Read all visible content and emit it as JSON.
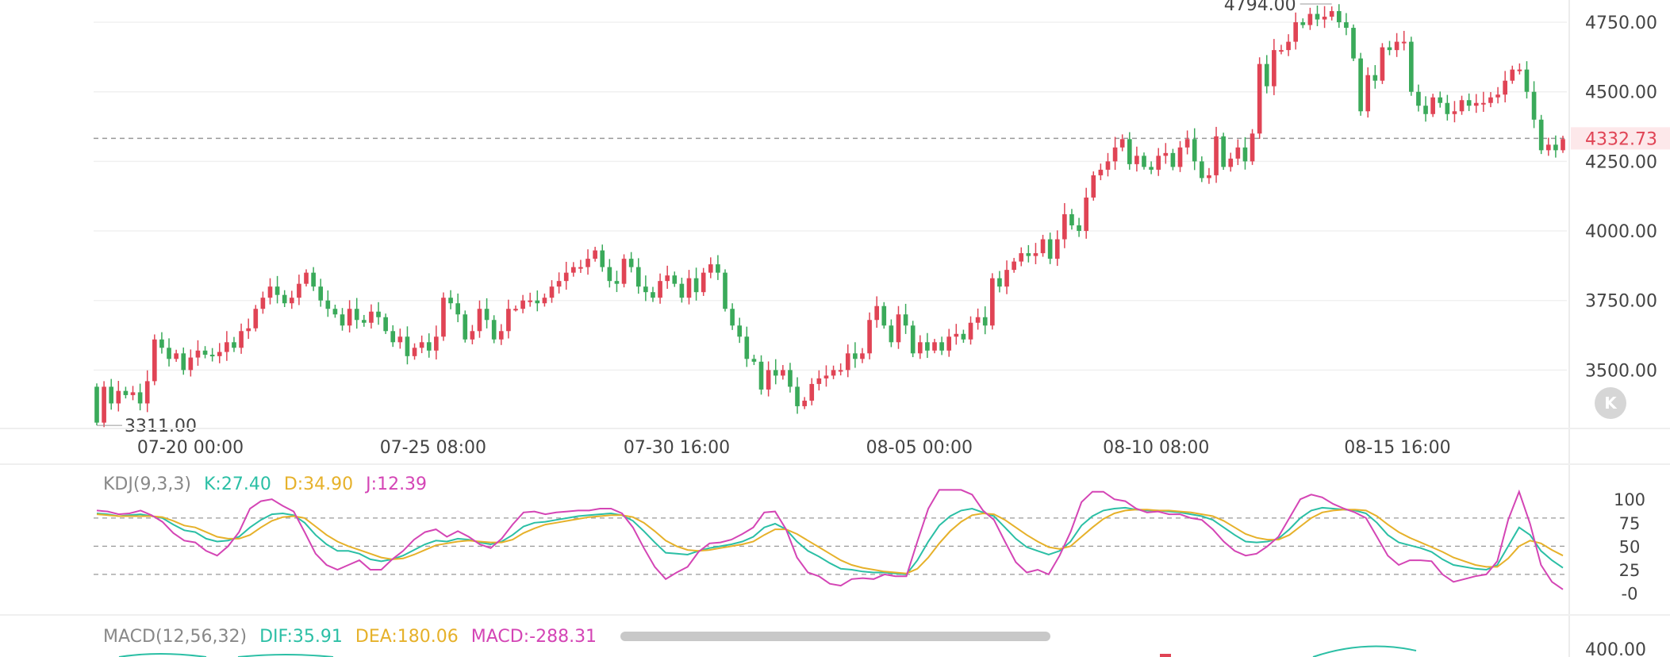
{
  "chart_data": [
    {
      "type": "candlestick",
      "panel": "price",
      "x_tick_labels": [
        "07-20 00:00",
        "07-25 08:00",
        "07-30 16:00",
        "08-05 00:00",
        "08-10 08:00",
        "08-15 16:00"
      ],
      "y_tick_labels": [
        "4750.00",
        "4500.00",
        "4250.00",
        "4000.00",
        "3750.00",
        "3500.00"
      ],
      "ylim": [
        3290,
        4830
      ],
      "high_label": "4794.00",
      "low_label": "3311.00",
      "last_price_label": "4332.73",
      "last_price": 4332.73,
      "colors": {
        "up": "#e04455",
        "down": "#3aaa5a",
        "last_price": "#e04455"
      },
      "series": [
        {
          "name": "close",
          "values": [
            3311,
            3440,
            3380,
            3425,
            3410,
            3420,
            3380,
            3460,
            3610,
            3580,
            3540,
            3560,
            3500,
            3545,
            3570,
            3555,
            3550,
            3565,
            3600,
            3580,
            3640,
            3650,
            3720,
            3760,
            3800,
            3770,
            3740,
            3760,
            3810,
            3850,
            3800,
            3750,
            3720,
            3700,
            3660,
            3720,
            3680,
            3670,
            3710,
            3690,
            3640,
            3600,
            3620,
            3550,
            3580,
            3600,
            3570,
            3620,
            3760,
            3740,
            3700,
            3610,
            3640,
            3720,
            3680,
            3610,
            3640,
            3720,
            3720,
            3750,
            3750,
            3740,
            3760,
            3800,
            3820,
            3850,
            3870,
            3870,
            3900,
            3930,
            3870,
            3820,
            3810,
            3900,
            3870,
            3800,
            3780,
            3760,
            3820,
            3840,
            3810,
            3760,
            3830,
            3780,
            3850,
            3880,
            3850,
            3720,
            3660,
            3620,
            3540,
            3530,
            3430,
            3500,
            3480,
            3500,
            3440,
            3370,
            3390,
            3450,
            3470,
            3480,
            3500,
            3500,
            3560,
            3540,
            3560,
            3680,
            3730,
            3660,
            3600,
            3700,
            3660,
            3560,
            3600,
            3570,
            3600,
            3570,
            3620,
            3630,
            3610,
            3670,
            3690,
            3660,
            3830,
            3800,
            3860,
            3890,
            3920,
            3910,
            3920,
            3970,
            3900,
            3970,
            4060,
            4020,
            4000,
            4120,
            4200,
            4220,
            4250,
            4300,
            4330,
            4240,
            4270,
            4230,
            4220,
            4270,
            4280,
            4230,
            4300,
            4330,
            4250,
            4190,
            4200,
            4340,
            4230,
            4260,
            4300,
            4250,
            4350,
            4600,
            4520,
            4650,
            4650,
            4680,
            4750,
            4740,
            4780,
            4760,
            4770,
            4790,
            4750,
            4730,
            4620,
            4430,
            4560,
            4540,
            4660,
            4650,
            4680,
            4680,
            4500,
            4450,
            4420,
            4480,
            4460,
            4420,
            4430,
            4470,
            4450,
            4460,
            4460,
            4480,
            4490,
            4540,
            4580,
            4580,
            4500,
            4400,
            4290,
            4310,
            4290,
            4330
          ]
        }
      ]
    },
    {
      "type": "line",
      "panel": "KDJ",
      "y_tick_labels": [
        "100",
        "75",
        "50",
        "25",
        "-0"
      ],
      "ylim": [
        -8,
        112
      ],
      "reference_lines": [
        80,
        50,
        20
      ],
      "x": [
        0,
        10,
        20,
        30,
        40,
        50,
        60,
        70,
        80,
        90,
        100,
        110,
        120,
        130,
        140,
        150,
        160,
        170,
        180,
        190,
        200,
        210,
        220,
        230,
        240,
        250,
        260,
        270,
        280,
        290,
        300,
        310,
        320,
        330,
        340,
        350,
        360,
        370,
        380,
        390,
        400,
        410,
        420,
        430,
        440,
        450,
        460,
        470,
        480,
        490,
        500,
        510,
        520,
        530,
        540,
        550,
        560,
        570,
        580,
        590,
        600,
        610,
        620,
        630,
        640,
        650,
        660,
        670,
        680,
        690,
        700,
        710,
        720,
        730,
        740,
        750,
        760,
        770,
        780,
        790,
        800,
        810,
        820,
        830,
        840,
        850,
        860,
        870,
        880,
        890,
        900,
        910,
        920,
        930,
        940,
        950,
        960,
        970,
        980,
        990,
        1000,
        1010,
        1020,
        1030,
        1040,
        1050,
        1060,
        1070,
        1080,
        1090,
        1100,
        1110,
        1120,
        1130,
        1140,
        1150,
        1160,
        1170,
        1180,
        1190,
        1200,
        1210,
        1220,
        1230,
        1240,
        1250,
        1260,
        1270,
        1280,
        1290,
        1300,
        1310,
        1320,
        1330,
        1340,
        1350,
        1360,
        1370,
        1380,
        1390,
        1400,
        1410,
        1420,
        1430,
        1440,
        1450,
        1460,
        1470,
        1480,
        1490,
        1500,
        1510,
        1520,
        1530,
        1540,
        1550,
        1560,
        1570,
        1580,
        1590,
        1600,
        1610,
        1620,
        1630,
        1640,
        1650,
        1660,
        1670,
        1680,
        1690,
        1700,
        1710,
        1720,
        1730,
        1740,
        1750,
        1760,
        1770,
        1780,
        1790,
        1800,
        1810,
        1820,
        1830,
        1840,
        1850,
        1860,
        1870,
        1880,
        1890,
        1900,
        1910,
        1920,
        1930,
        1940,
        1950,
        1960,
        1970,
        1980,
        1990,
        2000,
        2010,
        2020,
        2030,
        2040,
        2050,
        2060,
        2070,
        2080,
        2090,
        2100,
        2110,
        2120,
        2130,
        2140,
        2150,
        2160,
        2170,
        2180,
        2190,
        2200,
        2210,
        2220,
        2230,
        2240,
        2250,
        2260,
        2270,
        2280,
        2290,
        2300,
        2310,
        2320,
        2330,
        2340,
        2350,
        2360,
        2370,
        2380,
        2390,
        2400,
        2410,
        2420,
        2430,
        2440,
        2450,
        2460,
        2470,
        2480,
        2490,
        2500,
        2510,
        2520,
        2530,
        2540,
        2550,
        2560,
        2570,
        2580,
        2590,
        2600,
        2610,
        2620,
        2630,
        2640,
        2650,
        2660,
        2670,
        2680,
        2690,
        2700,
        2710,
        2720,
        2730,
        2740,
        2750,
        2760,
        2770,
        2780,
        2790,
        2800,
        2810,
        2820,
        2830,
        2840,
        2850,
        2860,
        2870,
        2880,
        2890,
        2900,
        2910,
        2920,
        2930,
        2940,
        2950,
        2960,
        2970,
        2980,
        2990,
        3000,
        3010,
        3020,
        3030,
        3040,
        3050,
        3060,
        3070,
        3080,
        3090,
        3100,
        3110,
        3120,
        3130,
        3140,
        3150,
        3160,
        3170,
        3180,
        3190,
        3200,
        3210,
        3220,
        3230,
        3240,
        3250,
        3260,
        3270,
        3280,
        3290,
        3300,
        3310,
        3320,
        3330,
        3340,
        3350,
        3360,
        3370,
        3380,
        3390,
        3400,
        3410,
        3420,
        3430,
        3440,
        3450,
        3460,
        3470,
        3480,
        3490,
        3500,
        3510,
        3520,
        3530,
        3540,
        3550,
        3560,
        3570,
        3580,
        3590,
        3600,
        3610,
        3620,
        3630,
        3640,
        3650,
        3660,
        3670,
        3680,
        3690,
        3700,
        3710,
        3720,
        3730,
        3740,
        3750,
        3760,
        3770,
        3780,
        3790,
        3800,
        3810,
        3820,
        3830,
        3840,
        3850,
        3860,
        3870,
        3880,
        3890,
        3900,
        3910,
        3920,
        3930,
        3940,
        3950,
        3960,
        3970,
        3980,
        3990,
        4000,
        4010,
        4020,
        4030,
        4040,
        4050,
        4060,
        4070,
        4080,
        4090,
        4100,
        4110,
        4120,
        4130,
        4140,
        4150,
        4160,
        4170,
        4180,
        4190,
        4200,
        4210,
        4220,
        4230,
        4240,
        4250,
        4260,
        4270,
        4280,
        4290,
        4300,
        4310,
        4320,
        4330,
        4340,
        4350,
        4360,
        4370,
        4380,
        4390,
        4400,
        4410,
        4420,
        4430,
        4440,
        4450,
        4460,
        4470,
        4480,
        4490,
        4500
      ],
      "series": [
        {
          "name": "K",
          "color": "#2bbfa5",
          "values": [
            85,
            84,
            82,
            83,
            84,
            82,
            80,
            73,
            67,
            65,
            58,
            55,
            56,
            60,
            70,
            78,
            84,
            85,
            83,
            75,
            62,
            52,
            45,
            45,
            42,
            36,
            34,
            36,
            40,
            46,
            52,
            56,
            55,
            58,
            57,
            54,
            52,
            55,
            62,
            71,
            75,
            76,
            78,
            80,
            82,
            83,
            84,
            85,
            83,
            77,
            66,
            54,
            43,
            42,
            41,
            45,
            48,
            50,
            52,
            55,
            60,
            70,
            74,
            68,
            55,
            45,
            39,
            32,
            26,
            25,
            23,
            22,
            22,
            21,
            20,
            35,
            55,
            72,
            82,
            88,
            90,
            86,
            82,
            70,
            58,
            49,
            45,
            41,
            45,
            55,
            72,
            82,
            88,
            90,
            91,
            89,
            88,
            88,
            87,
            86,
            84,
            82,
            78,
            70,
            62,
            55,
            54,
            55,
            58,
            68,
            80,
            88,
            91,
            90,
            89,
            88,
            85,
            75,
            62,
            54,
            51,
            48,
            44,
            36,
            30,
            28,
            26,
            25,
            30,
            50,
            70,
            62,
            45,
            35,
            27
          ]
        },
        {
          "name": "D",
          "color": "#e6b12a",
          "values": [
            84,
            83,
            82,
            82,
            82,
            82,
            81,
            77,
            72,
            70,
            65,
            60,
            58,
            58,
            62,
            70,
            77,
            81,
            82,
            80,
            71,
            62,
            55,
            50,
            46,
            42,
            38,
            36,
            37,
            41,
            46,
            51,
            53,
            55,
            56,
            55,
            54,
            54,
            57,
            64,
            69,
            73,
            75,
            77,
            79,
            81,
            82,
            83,
            83,
            81,
            75,
            66,
            56,
            50,
            46,
            45,
            46,
            48,
            50,
            52,
            55,
            62,
            68,
            68,
            63,
            56,
            49,
            42,
            35,
            30,
            27,
            25,
            23,
            22,
            21,
            26,
            38,
            53,
            66,
            76,
            83,
            85,
            84,
            78,
            70,
            62,
            55,
            49,
            47,
            50,
            60,
            70,
            79,
            85,
            88,
            89,
            89,
            88,
            88,
            87,
            86,
            84,
            82,
            77,
            70,
            63,
            59,
            57,
            57,
            62,
            71,
            80,
            86,
            88,
            89,
            89,
            88,
            82,
            73,
            65,
            59,
            54,
            49,
            44,
            38,
            34,
            30,
            28,
            28,
            37,
            50,
            56,
            53,
            46,
            40
          ]
        },
        {
          "name": "J",
          "color": "#d445b5",
          "values": [
            88,
            87,
            84,
            85,
            88,
            83,
            76,
            64,
            56,
            54,
            45,
            40,
            50,
            65,
            90,
            98,
            100,
            93,
            87,
            65,
            42,
            30,
            25,
            30,
            35,
            25,
            25,
            36,
            45,
            57,
            65,
            68,
            60,
            66,
            60,
            52,
            48,
            58,
            73,
            86,
            87,
            84,
            86,
            87,
            88,
            88,
            90,
            90,
            85,
            70,
            48,
            28,
            15,
            22,
            28,
            44,
            53,
            54,
            57,
            63,
            70,
            86,
            87,
            68,
            38,
            22,
            18,
            10,
            8,
            15,
            16,
            15,
            20,
            18,
            18,
            55,
            90,
            110,
            110,
            110,
            105,
            88,
            78,
            55,
            33,
            22,
            25,
            20,
            40,
            65,
            97,
            108,
            108,
            100,
            98,
            90,
            86,
            87,
            84,
            84,
            80,
            78,
            68,
            55,
            45,
            40,
            42,
            50,
            60,
            80,
            100,
            105,
            102,
            95,
            90,
            86,
            80,
            60,
            40,
            30,
            35,
            35,
            34,
            20,
            12,
            15,
            18,
            20,
            34,
            78,
            108,
            74,
            30,
            12,
            4
          ]
        }
      ],
      "legend": {
        "title": "KDJ(9,3,3)",
        "K": "K:27.40",
        "D": "D:34.90",
        "J": "J:12.39"
      }
    },
    {
      "type": "line",
      "panel": "MACD",
      "y_tick_labels": [
        "400.00"
      ],
      "legend": {
        "title": "MACD(12,56,32)",
        "DIF": "DIF:35.91",
        "DEA": "DEA:180.06",
        "MACD": "MACD:-288.31"
      }
    }
  ],
  "ui": {
    "k_button_label": "K"
  }
}
